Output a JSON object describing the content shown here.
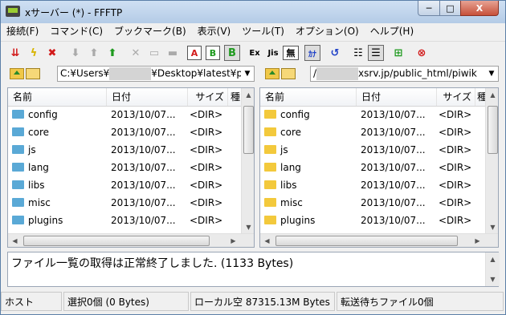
{
  "window": {
    "title": "xサーバー (*) - FFFTP",
    "buttons": {
      "minimize": "─",
      "maximize": "□",
      "close": "X"
    }
  },
  "menu": [
    "接続(F)",
    "コマンド(C)",
    "ブックマーク(B)",
    "表示(V)",
    "ツール(T)",
    "オプション(O)",
    "ヘルプ(H)"
  ],
  "toolbar": {
    "connect_icon": "connect-icon",
    "quick_connect_icon": "lightning-icon",
    "disconnect_icon": "disconnect-icon",
    "ascii_label": "A",
    "binary_label": "B",
    "auto_label": "B",
    "euc_label": "Ex",
    "jis_label": "Jis",
    "no_convert_label": "無",
    "kana_label": "ｶﾅ",
    "accent_red": "#d21a1a",
    "accent_green": "#1e9a1e",
    "accent_blue": "#2042c8"
  },
  "local": {
    "path_prefix": "C:¥Users¥",
    "path_suffix": "¥Desktop¥latest¥piwik",
    "columns": [
      "名前",
      "日付",
      "サイズ",
      "種"
    ],
    "files": [
      {
        "name": "config",
        "date": "2013/10/07...",
        "size": "<DIR>"
      },
      {
        "name": "core",
        "date": "2013/10/07...",
        "size": "<DIR>"
      },
      {
        "name": "js",
        "date": "2013/10/07...",
        "size": "<DIR>"
      },
      {
        "name": "lang",
        "date": "2013/10/07...",
        "size": "<DIR>"
      },
      {
        "name": "libs",
        "date": "2013/10/07...",
        "size": "<DIR>"
      },
      {
        "name": "misc",
        "date": "2013/10/07...",
        "size": "<DIR>"
      },
      {
        "name": "plugins",
        "date": "2013/10/07...",
        "size": "<DIR>"
      }
    ]
  },
  "remote": {
    "path_prefix": "/",
    "path_suffix": "xsrv.jp/public_html/piwik",
    "columns": [
      "名前",
      "日付",
      "サイズ",
      "種"
    ],
    "files": [
      {
        "name": "config",
        "date": "2013/10/07...",
        "size": "<DIR>"
      },
      {
        "name": "core",
        "date": "2013/10/07...",
        "size": "<DIR>"
      },
      {
        "name": "js",
        "date": "2013/10/07...",
        "size": "<DIR>"
      },
      {
        "name": "lang",
        "date": "2013/10/07...",
        "size": "<DIR>"
      },
      {
        "name": "libs",
        "date": "2013/10/07...",
        "size": "<DIR>"
      },
      {
        "name": "misc",
        "date": "2013/10/07...",
        "size": "<DIR>"
      },
      {
        "name": "plugins",
        "date": "2013/10/07...",
        "size": "<DIR>"
      }
    ]
  },
  "log": {
    "message": "ファイル一覧の取得は正常終了しました. (1133 Bytes)"
  },
  "status": {
    "host": "ホスト",
    "selected": "選択0個 (0 Bytes)",
    "local_free": "ローカル空 87315.13M Bytes",
    "queue": "転送待ちファイル0個"
  },
  "colors": {
    "local_folder": "#5aa9d6",
    "remote_folder": "#f3c93c"
  }
}
